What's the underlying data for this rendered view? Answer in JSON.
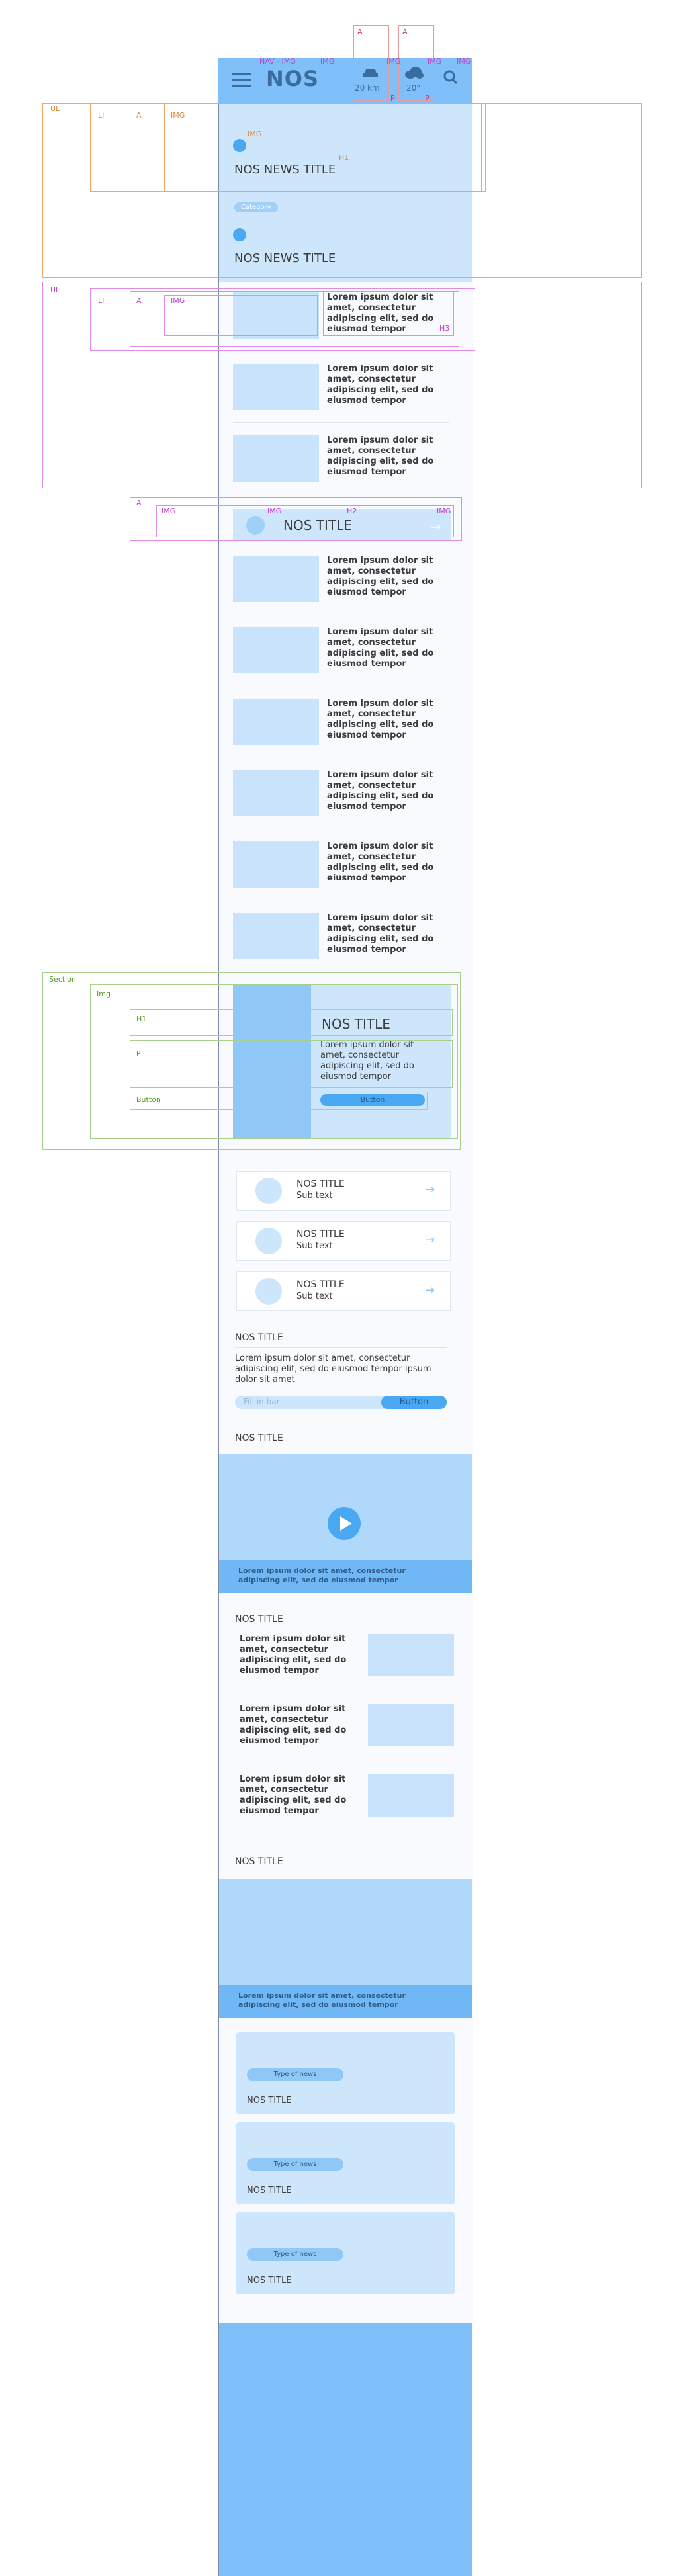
{
  "nav": {
    "logo": "NOS",
    "weather1": "20 km",
    "weather2": "20°"
  },
  "annotations": {
    "nav": "NAV - IMG",
    "img": "IMG",
    "a": "A",
    "p": "P",
    "ul": "UL",
    "li": "LI",
    "h1": "H1",
    "h2": "H2",
    "h3": "H3",
    "section": "Section",
    "img2": "Img",
    "pp": "P",
    "button": "Button"
  },
  "hero": {
    "title1": "NOS NEWS TITLE",
    "tag": "Category",
    "title2": "NOS NEWS TITLE"
  },
  "list1": {
    "item": "Lorem ipsum dolor sit amet, consectetur adipiscing elit, sed do eiusmod tempor"
  },
  "banner": {
    "title": "NOS TITLE"
  },
  "section": {
    "title": "NOS TITLE",
    "text": "Lorem ipsum dolor sit amet, consectetur adipiscing elit, sed do eiusmod tempor",
    "button": "Button"
  },
  "rows": [
    {
      "title": "NOS TITLE",
      "sub": "Sub text"
    },
    {
      "title": "NOS TITLE",
      "sub": "Sub text"
    },
    {
      "title": "NOS TITLE",
      "sub": "Sub text"
    }
  ],
  "form": {
    "title": "NOS TITLE",
    "text": "Lorem ipsum dolor sit amet, consectetur adipiscing elit, sed do eiusmod tempor ipsum dolor sit amet",
    "placeholder": "Fill in bar",
    "button": "Button"
  },
  "video": {
    "title": "NOS TITLE",
    "caption": "Lorem ipsum dolor sit amet, consectetur adipiscing elit, sed do eiusmod tempor"
  },
  "list2": {
    "title": "NOS TITLE",
    "item": "Lorem ipsum dolor sit amet, consectetur adipiscing elit, sed do eiusmod tempor"
  },
  "gallery": {
    "title": "NOS TITLE",
    "caption": "Lorem ipsum dolor sit amet, consectetur adipiscing elit, sed do eiusmod tempor"
  },
  "cards": [
    {
      "tag": "Type of news",
      "title": "NOS TITLE"
    },
    {
      "tag": "Type of news",
      "title": "NOS TITLE"
    },
    {
      "tag": "Type of news",
      "title": "NOS TITLE"
    }
  ]
}
